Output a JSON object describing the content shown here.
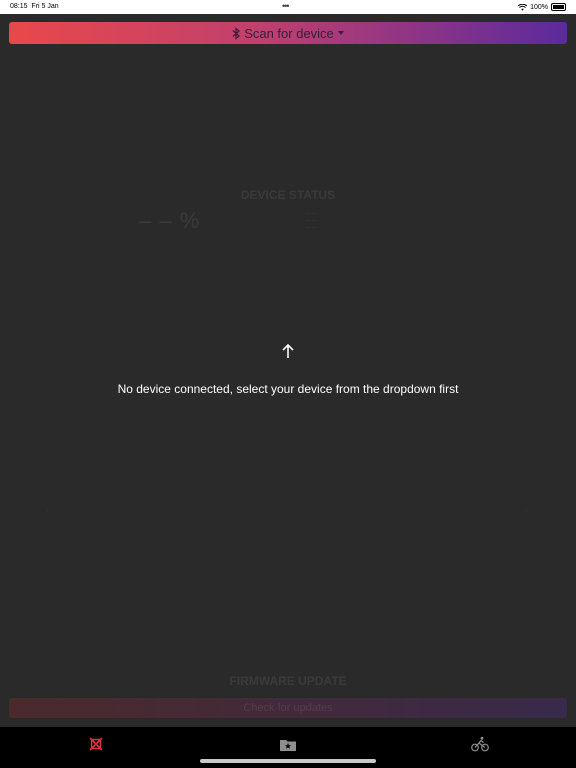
{
  "status_bar": {
    "time": "08:15",
    "date": "Fri 5 Jan",
    "dots": "•••",
    "battery": "100%"
  },
  "scan": {
    "label": "Scan for device",
    "bluetooth_icon": "bluetooth-icon",
    "caret_icon": "caret-down-icon"
  },
  "device_status": {
    "title": "DEVICE STATUS",
    "battery_percent": "– – %",
    "stats": [
      "— —",
      "— —",
      "— —"
    ]
  },
  "notice": {
    "arrow_icon": "arrow-up-icon",
    "text": "No device connected, select your device from the dropdown first"
  },
  "firmware": {
    "title": "FIRMWARE UPDATE",
    "button_label": "Check for updates"
  },
  "tabs": [
    {
      "name": "device",
      "icon": "device-icon",
      "active": true
    },
    {
      "name": "favorites",
      "icon": "folder-star-icon",
      "active": false
    },
    {
      "name": "ride",
      "icon": "bicycle-icon",
      "active": false
    }
  ],
  "colors": {
    "accent_red": "#e9484a",
    "accent_purple": "#5b2a9c",
    "background": "#2a2a2a"
  }
}
